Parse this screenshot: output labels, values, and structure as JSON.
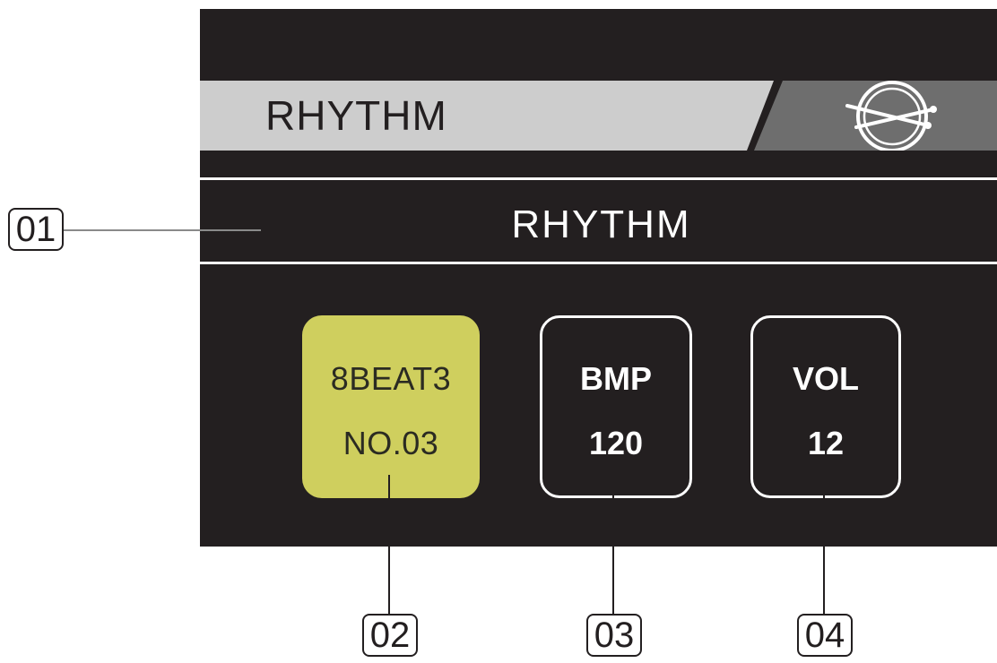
{
  "header": {
    "title": "RHYTHM",
    "icon": "drumsticks-icon"
  },
  "mode_label": "RHYTHM",
  "params": {
    "rhythm": {
      "name": "8BEAT3",
      "number": "NO.03"
    },
    "bmp": {
      "label": "BMP",
      "value": "120"
    },
    "vol": {
      "label": "VOL",
      "value": "12"
    }
  },
  "callouts": [
    "01",
    "02",
    "03",
    "04"
  ],
  "colors": {
    "screen_bg": "#231f20",
    "header_light": "#cdcdcd",
    "header_dark": "#6e6e6e",
    "highlight": "#cfcf5e"
  }
}
